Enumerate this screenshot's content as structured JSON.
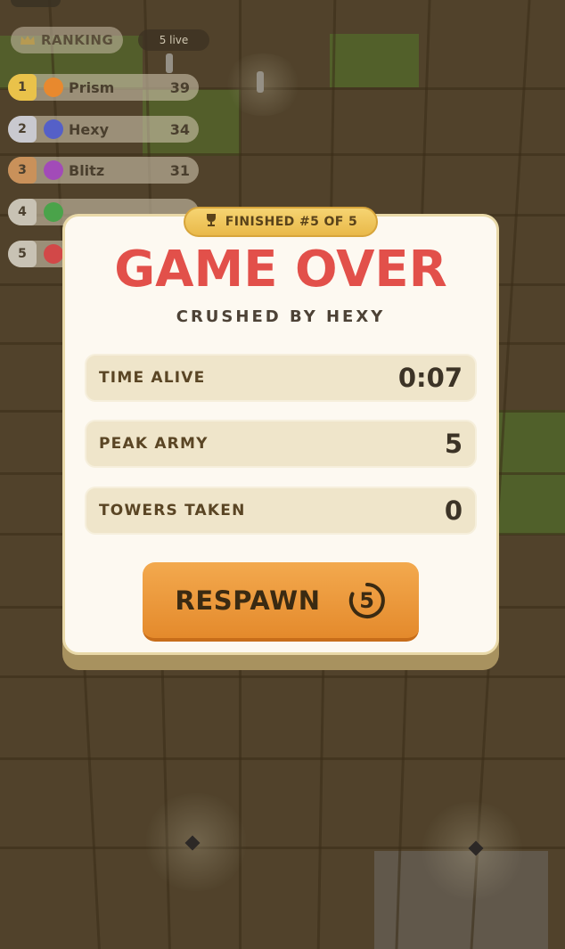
{
  "hud": {
    "ranking_title": "RANKING",
    "live_count": "5 live",
    "rankings": [
      {
        "rank": "1",
        "name": "Prism",
        "score": "39",
        "color": "#e8892e",
        "badge": "#e9c24a"
      },
      {
        "rank": "2",
        "name": "Hexy",
        "score": "34",
        "color": "#5560c8",
        "badge": "#c9c9cf"
      },
      {
        "rank": "3",
        "name": "Blitz",
        "score": "31",
        "color": "#a24bb8",
        "badge": "#c9915a"
      },
      {
        "rank": "4",
        "name": "",
        "score": "",
        "color": "#4aa34a",
        "badge": "#c8c2b4"
      },
      {
        "rank": "5",
        "name": "",
        "score": "",
        "color": "#d24848",
        "badge": "#c8c2b4"
      }
    ]
  },
  "dialog": {
    "badge_icon": "trophy-icon",
    "badge_text": "FINISHED #5 OF 5",
    "title": "GAME OVER",
    "subtitle": "CRUSHED BY HEXY",
    "stats": [
      {
        "label": "TIME ALIVE",
        "value": "0:07"
      },
      {
        "label": "PEAK ARMY",
        "value": "5"
      },
      {
        "label": "TOWERS TAKEN",
        "value": "0"
      }
    ],
    "respawn_label": "RESPAWN",
    "countdown": "5"
  },
  "colors": {
    "title": "#e2504a",
    "button": "#ec9a3c",
    "badge": "#f1c85e"
  }
}
